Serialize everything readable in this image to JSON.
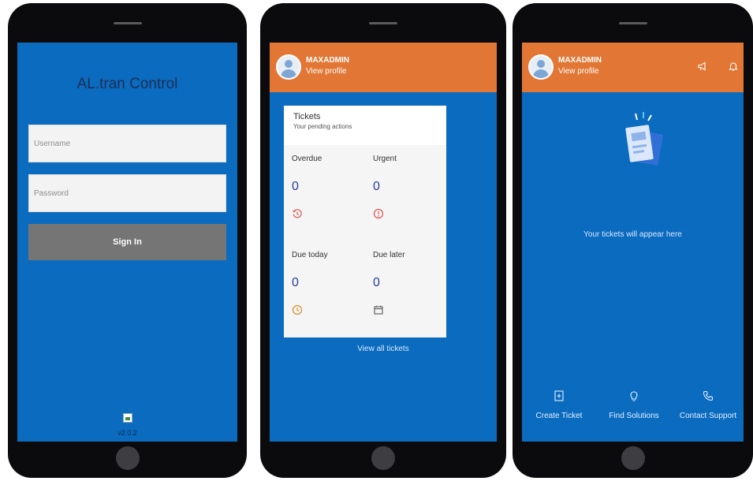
{
  "login": {
    "app_title": "AL.tran Control",
    "username_placeholder": "Username",
    "password_placeholder": "Password",
    "signin_label": "Sign In",
    "version": "v2.0.2"
  },
  "header": {
    "user_name": "MAXADMIN",
    "view_profile": "View profile"
  },
  "tickets": {
    "title": "Tickets",
    "subtitle": "Your pending actions",
    "tiles": [
      {
        "label": "Overdue",
        "value": "0",
        "icon": "history-icon"
      },
      {
        "label": "Urgent",
        "value": "0",
        "icon": "alert-circle-icon"
      },
      {
        "label": "Due today",
        "value": "0",
        "icon": "clock-icon"
      },
      {
        "label": "Due later",
        "value": "0",
        "icon": "calendar-icon"
      }
    ],
    "view_all": "View all tickets"
  },
  "home": {
    "empty_message": "Your tickets will appear here",
    "actions": [
      {
        "label": "Create Ticket",
        "icon": "create-ticket-icon"
      },
      {
        "label": "Find Solutions",
        "icon": "lightbulb-icon"
      },
      {
        "label": "Contact Support",
        "icon": "phone-icon"
      }
    ]
  },
  "colors": {
    "screen_blue": "#0a6bbf",
    "header_orange": "#e27735",
    "signin_gray": "#757575",
    "value_blue": "#2a3c9b",
    "icon_red": "#d9534f",
    "icon_orange": "#d88a2a"
  }
}
